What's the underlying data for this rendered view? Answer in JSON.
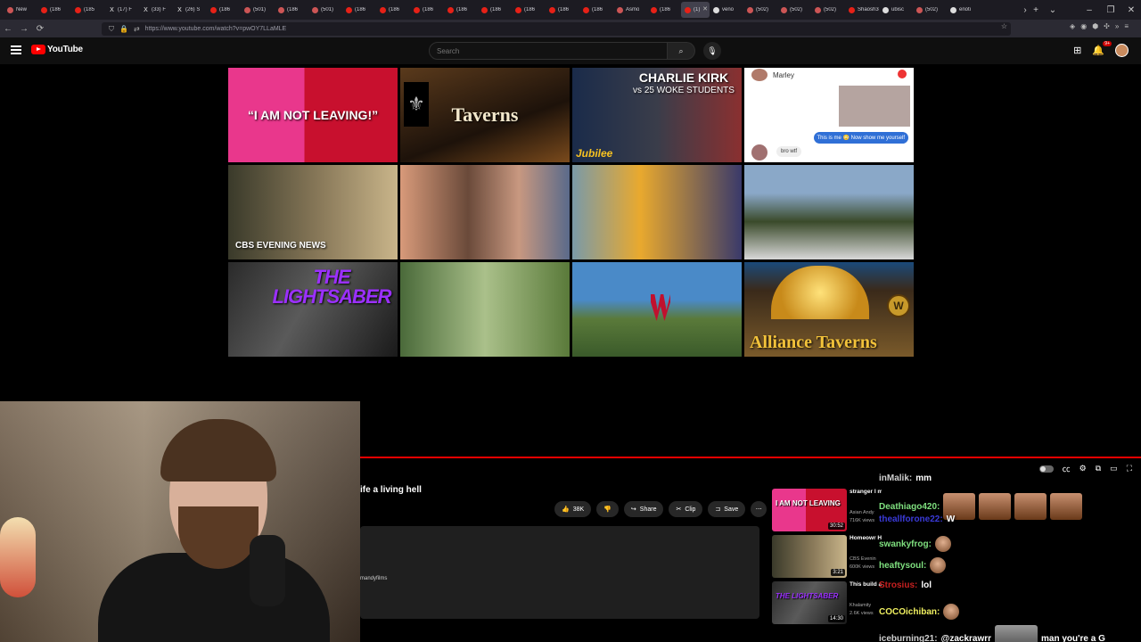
{
  "browser": {
    "tabs": [
      {
        "label": "New",
        "fav": "r"
      },
      {
        "label": "(186",
        "fav": ""
      },
      {
        "label": "(185",
        "fav": ""
      },
      {
        "label": "(17) F",
        "fav": "x"
      },
      {
        "label": "(33) F",
        "fav": "x"
      },
      {
        "label": "(26) S",
        "fav": "x"
      },
      {
        "label": "(186",
        "fav": ""
      },
      {
        "label": "(501)",
        "fav": "r"
      },
      {
        "label": "(186",
        "fav": "r"
      },
      {
        "label": "(501)",
        "fav": "r"
      },
      {
        "label": "(186",
        "fav": ""
      },
      {
        "label": "(186",
        "fav": ""
      },
      {
        "label": "(186",
        "fav": ""
      },
      {
        "label": "(186",
        "fav": ""
      },
      {
        "label": "(186",
        "fav": ""
      },
      {
        "label": "(186",
        "fav": ""
      },
      {
        "label": "(186",
        "fav": ""
      },
      {
        "label": "(186",
        "fav": ""
      },
      {
        "label": "Asmo",
        "fav": "r"
      },
      {
        "label": "(186",
        "fav": ""
      },
      {
        "label": "(1)",
        "fav": "",
        "active": true
      },
      {
        "label": "veno",
        "fav": "g"
      },
      {
        "label": "(502)",
        "fav": "r"
      },
      {
        "label": "(502)",
        "fav": "r"
      },
      {
        "label": "(502)",
        "fav": "r"
      },
      {
        "label": "Shaosh3d",
        "fav": ""
      },
      {
        "label": "ubisc",
        "fav": "g"
      },
      {
        "label": "(502)",
        "fav": "r"
      },
      {
        "label": "enoti",
        "fav": "g"
      }
    ],
    "url": "https://www.youtube.com/watch?v=pwOY7LLaMLE"
  },
  "youtube": {
    "logo_text": "YouTube",
    "search_placeholder": "Search",
    "notifications_badge": "9+"
  },
  "grid": [
    {
      "caption": "“I AM NOT LEAVING!”",
      "style": "t1"
    },
    {
      "caption": "Taverns",
      "style": "t2"
    },
    {
      "caption": "CHARLIE KIRK",
      "sub": "vs 25 WOKE STUDENTS",
      "badge": "Jubilee",
      "style": "t3"
    },
    {
      "caption": "",
      "contact": "Marley",
      "bubble_out": "This is me 😳 Now show me yourself",
      "bubble_in": "bro wtf",
      "style": "t4"
    },
    {
      "caption": "CBS EVENING NEWS",
      "style": "t5"
    },
    {
      "caption": "",
      "style": "t6"
    },
    {
      "caption": "",
      "style": "t7"
    },
    {
      "caption": "",
      "style": "t8"
    },
    {
      "caption": "THE LIGHTSABER",
      "style": "t9"
    },
    {
      "caption": "",
      "style": "t10"
    },
    {
      "caption": "",
      "style": "t11"
    },
    {
      "caption": "Alliance Taverns",
      "style": "t12"
    }
  ],
  "video": {
    "title": "ife a living hell",
    "like_count": "38K",
    "share_label": "Share",
    "clip_label": "Clip",
    "save_label": "Save",
    "channel": "mandyfilms"
  },
  "recommendations": [
    {
      "title": "stranger l made her",
      "channel": "Asian Andy",
      "views": "716K views",
      "duration": "30:52",
      "mini": "I AM NOT LEAVING",
      "style": "rt1"
    },
    {
      "title": "Homeowr Hunter” to",
      "channel": "CBS Evenin",
      "views": "600K views",
      "duration": "3:21",
      "mini": "",
      "style": "rt2"
    },
    {
      "title": "This build anything",
      "channel": "Khalamity",
      "views": "2.6K views",
      "duration": "14:30",
      "mini": "THE LIGHTSABER",
      "style": "rt3"
    }
  ],
  "chat": [
    {
      "user": "inMalik:",
      "text": "mm",
      "color": "#d0d0d0",
      "emote": ""
    },
    {
      "user": "Deathiago420:",
      "text": "",
      "color": "#7fe07f",
      "emote": "row"
    },
    {
      "user": "theallforone22:",
      "text": "W",
      "color": "#3a3ad8",
      "emote": ""
    },
    {
      "user": "swankyfrog:",
      "text": "",
      "color": "#7fe07f",
      "emote": "one"
    },
    {
      "user": "heaftysoul:",
      "text": "",
      "color": "#7fe07f",
      "emote": "one"
    },
    {
      "user": "Strosius:",
      "text": "lol",
      "color": "#c82020",
      "emote": ""
    },
    {
      "user": "COCOichiban:",
      "text": "",
      "color": "#f0f060",
      "emote": "one"
    },
    {
      "user": "iceburning21:",
      "text": "@zackrawrr",
      "color": "#d0d0d0",
      "emote": "sq",
      "tail": "man you're a G"
    }
  ]
}
